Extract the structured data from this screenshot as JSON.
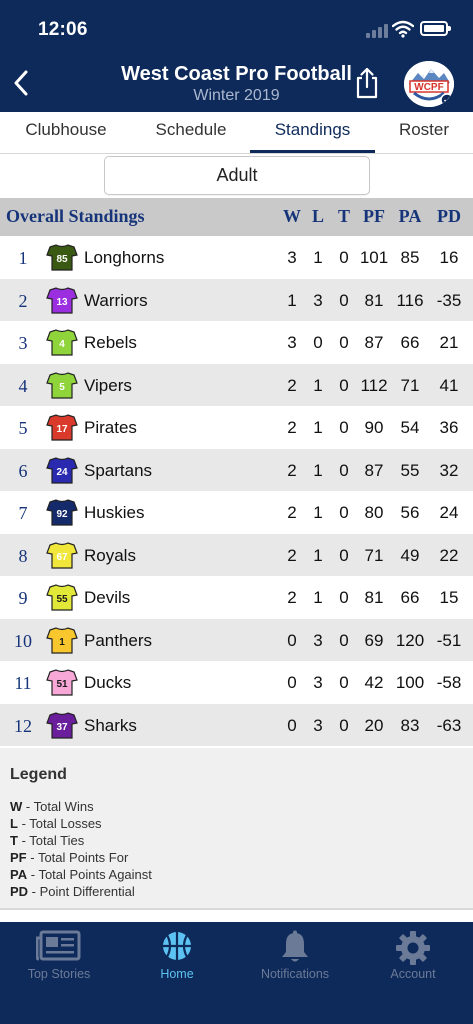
{
  "status_bar": {
    "time": "12:06"
  },
  "header": {
    "title": "West Coast Pro Football",
    "subtitle": "Winter 2019",
    "logo_text": "WCPF"
  },
  "tabs": [
    {
      "label": "Clubhouse",
      "active": false
    },
    {
      "label": "Schedule",
      "active": false
    },
    {
      "label": "Standings",
      "active": true
    },
    {
      "label": "Roster",
      "active": false
    }
  ],
  "division": {
    "selected": "Adult"
  },
  "standings": {
    "title": "Overall Standings",
    "columns": [
      "W",
      "L",
      "T",
      "PF",
      "PA",
      "PD"
    ],
    "rows": [
      {
        "rank": "1",
        "team": "Longhorns",
        "jersey_number": "85",
        "jersey_color": "#3a5a14",
        "number_color": "#ffffff",
        "w": "3",
        "l": "1",
        "t": "0",
        "pf": "101",
        "pa": "85",
        "pd": "16"
      },
      {
        "rank": "2",
        "team": "Warriors",
        "jersey_number": "13",
        "jersey_color": "#9b2fe0",
        "number_color": "#ffffff",
        "w": "1",
        "l": "3",
        "t": "0",
        "pf": "81",
        "pa": "116",
        "pd": "-35"
      },
      {
        "rank": "3",
        "team": "Rebels",
        "jersey_number": "4",
        "jersey_color": "#8fd43b",
        "number_color": "#ffffff",
        "w": "3",
        "l": "0",
        "t": "0",
        "pf": "87",
        "pa": "66",
        "pd": "21"
      },
      {
        "rank": "4",
        "team": "Vipers",
        "jersey_number": "5",
        "jersey_color": "#8fd43b",
        "number_color": "#ffffff",
        "w": "2",
        "l": "1",
        "t": "0",
        "pf": "112",
        "pa": "71",
        "pd": "41"
      },
      {
        "rank": "5",
        "team": "Pirates",
        "jersey_number": "17",
        "jersey_color": "#d93a2b",
        "number_color": "#ffffff",
        "w": "2",
        "l": "1",
        "t": "0",
        "pf": "90",
        "pa": "54",
        "pd": "36"
      },
      {
        "rank": "6",
        "team": "Spartans",
        "jersey_number": "24",
        "jersey_color": "#2a2ab0",
        "number_color": "#ffffff",
        "w": "2",
        "l": "1",
        "t": "0",
        "pf": "87",
        "pa": "55",
        "pd": "32"
      },
      {
        "rank": "7",
        "team": "Huskies",
        "jersey_number": "92",
        "jersey_color": "#152a6b",
        "number_color": "#ffffff",
        "w": "2",
        "l": "1",
        "t": "0",
        "pf": "80",
        "pa": "56",
        "pd": "24"
      },
      {
        "rank": "8",
        "team": "Royals",
        "jersey_number": "67",
        "jersey_color": "#f1e63a",
        "number_color": "#ffffff",
        "w": "2",
        "l": "1",
        "t": "0",
        "pf": "71",
        "pa": "49",
        "pd": "22"
      },
      {
        "rank": "9",
        "team": "Devils",
        "jersey_number": "55",
        "jersey_color": "#e2e838",
        "number_color": "#1a1a1a",
        "w": "2",
        "l": "1",
        "t": "0",
        "pf": "81",
        "pa": "66",
        "pd": "15"
      },
      {
        "rank": "10",
        "team": "Panthers",
        "jersey_number": "1",
        "jersey_color": "#f7c72d",
        "number_color": "#1a1a1a",
        "w": "0",
        "l": "3",
        "t": "0",
        "pf": "69",
        "pa": "120",
        "pd": "-51"
      },
      {
        "rank": "11",
        "team": "Ducks",
        "jersey_number": "51",
        "jersey_color": "#f7a8d6",
        "number_color": "#1a1a1a",
        "w": "0",
        "l": "3",
        "t": "0",
        "pf": "42",
        "pa": "100",
        "pd": "-58"
      },
      {
        "rank": "12",
        "team": "Sharks",
        "jersey_number": "37",
        "jersey_color": "#6a1e9c",
        "number_color": "#ffffff",
        "w": "0",
        "l": "3",
        "t": "0",
        "pf": "20",
        "pa": "83",
        "pd": "-63"
      }
    ]
  },
  "legend": {
    "title": "Legend",
    "items": [
      {
        "abbr": "W",
        "desc": "Total Wins"
      },
      {
        "abbr": "L",
        "desc": "Total Losses"
      },
      {
        "abbr": "T",
        "desc": "Total Ties"
      },
      {
        "abbr": "PF",
        "desc": "Total Points For"
      },
      {
        "abbr": "PA",
        "desc": "Total Points Against"
      },
      {
        "abbr": "PD",
        "desc": "Point Differential"
      }
    ]
  },
  "bottom_nav": [
    {
      "label": "Top Stories",
      "icon": "newspaper-icon",
      "active": false
    },
    {
      "label": "Home",
      "icon": "ball-icon",
      "active": true
    },
    {
      "label": "Notifications",
      "icon": "bell-icon",
      "active": false
    },
    {
      "label": "Account",
      "icon": "gear-icon",
      "active": false
    }
  ],
  "colors": {
    "header_bg": "#0e2a5a",
    "accent": "#5cc2f2",
    "standings_title": "#16347a"
  }
}
